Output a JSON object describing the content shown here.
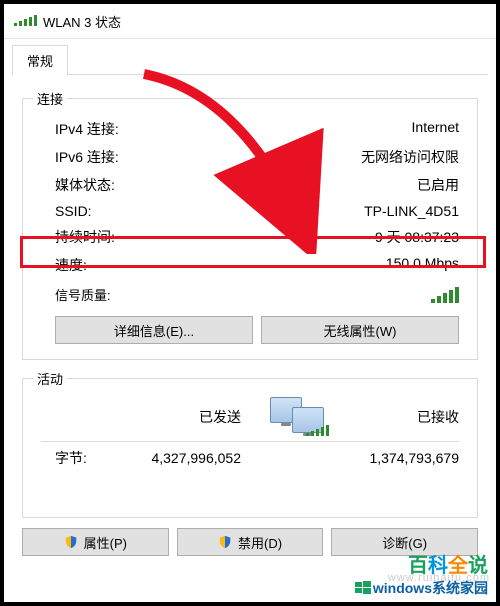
{
  "window": {
    "title": "WLAN 3 状态"
  },
  "tab": {
    "general": "常规"
  },
  "group_connection": {
    "legend": "连接",
    "ipv4_label": "IPv4 连接:",
    "ipv4_value": "Internet",
    "ipv6_label": "IPv6 连接:",
    "ipv6_value": "无网络访问权限",
    "media_label": "媒体状态:",
    "media_value": "已启用",
    "ssid_label": "SSID:",
    "ssid_value": "TP-LINK_4D51",
    "duration_label": "持续时间:",
    "duration_value": "9 天 08:37:23",
    "speed_label": "速度:",
    "speed_value": "150.0 Mbps",
    "signal_label": "信号质量:",
    "details_btn": "详细信息(E)...",
    "wireless_btn": "无线属性(W)"
  },
  "group_activity": {
    "legend": "活动",
    "sent": "已发送",
    "received": "已接收",
    "bytes_label": "字节:",
    "bytes_sent": "4,327,996,052",
    "bytes_recv": "1,374,793,679"
  },
  "buttons": {
    "properties": "属性(P)",
    "disable": "禁用(D)",
    "diagnose": "诊断(G)"
  },
  "watermark": "www.ruihaifu.com",
  "branding": {
    "bk": "百科全说",
    "sub": "windows系统家园"
  }
}
